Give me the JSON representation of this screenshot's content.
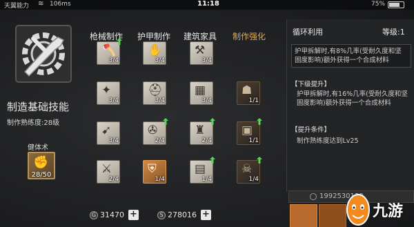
{
  "status_bar": {
    "carrier": "天翼能力",
    "speed": "106ms",
    "time": "11:18",
    "battery": "75%",
    "battery_level": 0.75
  },
  "left": {
    "skill_name": "制造基础技能",
    "skill_level": "制作熟练度:28级",
    "fitness_label": "健体术",
    "fitness_count": "28/50"
  },
  "tabs": [
    "枪械制作",
    "护甲制作",
    "建筑家具",
    "制作强化"
  ],
  "active_tab": 3,
  "grid": {
    "col0": [
      {
        "icon": "axe-icon",
        "level": "3/4",
        "upgrade": true
      },
      {
        "icon": "pistol-icon",
        "level": "3/4",
        "upgrade": false
      },
      {
        "icon": "rifle-icon",
        "level": "3/4",
        "upgrade": false
      },
      {
        "icon": "sword-icon",
        "level": "2/4",
        "upgrade": false
      }
    ],
    "col1": [
      {
        "icon": "gloves-icon",
        "level": "3/4",
        "upgrade": false
      },
      {
        "icon": "helmet-icon",
        "level": "3/4",
        "upgrade": false
      },
      {
        "icon": "boots-icon",
        "level": "2/4",
        "upgrade": true
      },
      {
        "icon": "armor-icon",
        "level": "1/4",
        "upgrade": false
      }
    ],
    "col2": [
      {
        "icon": "hammer-icon",
        "level": "3/4",
        "upgrade": false
      },
      {
        "icon": "brick-icon",
        "level": "3/4",
        "upgrade": false
      },
      {
        "icon": "chair-icon",
        "level": "2/4",
        "upgrade": true
      },
      {
        "icon": "wall-icon",
        "level": "1/4",
        "upgrade": true
      }
    ],
    "col3": [
      {
        "icon": "backpack-icon",
        "level": "1/1",
        "upgrade": false
      },
      {
        "icon": "crate-icon",
        "level": "1/1",
        "upgrade": true
      },
      {
        "icon": "mask-icon",
        "level": "1/4",
        "upgrade": true
      }
    ]
  },
  "currency": {
    "c1": "31470",
    "c2": "278016",
    "c1_symbol": "G",
    "c2_symbol": "S",
    "plus": "+"
  },
  "info": {
    "title": "循环利用",
    "level": "等级:1",
    "desc": "护甲拆解时,有8%几率(受耐久度和坚固度影响)额外获得一个合成材料",
    "next_label": "【下级提升】",
    "next_desc": "护甲拆解时,有16%几率(受耐久度和坚固度影响)额外获得一个合成材料",
    "cond_label": "【提升条件】",
    "cond_desc": "制作熟练度达到Lv25",
    "bottom_value": "1992530130"
  },
  "watermark": {
    "text": "九游"
  },
  "colors": {
    "accent": "#e0ab58",
    "upgrade_arrow": "#5fcf5f"
  }
}
